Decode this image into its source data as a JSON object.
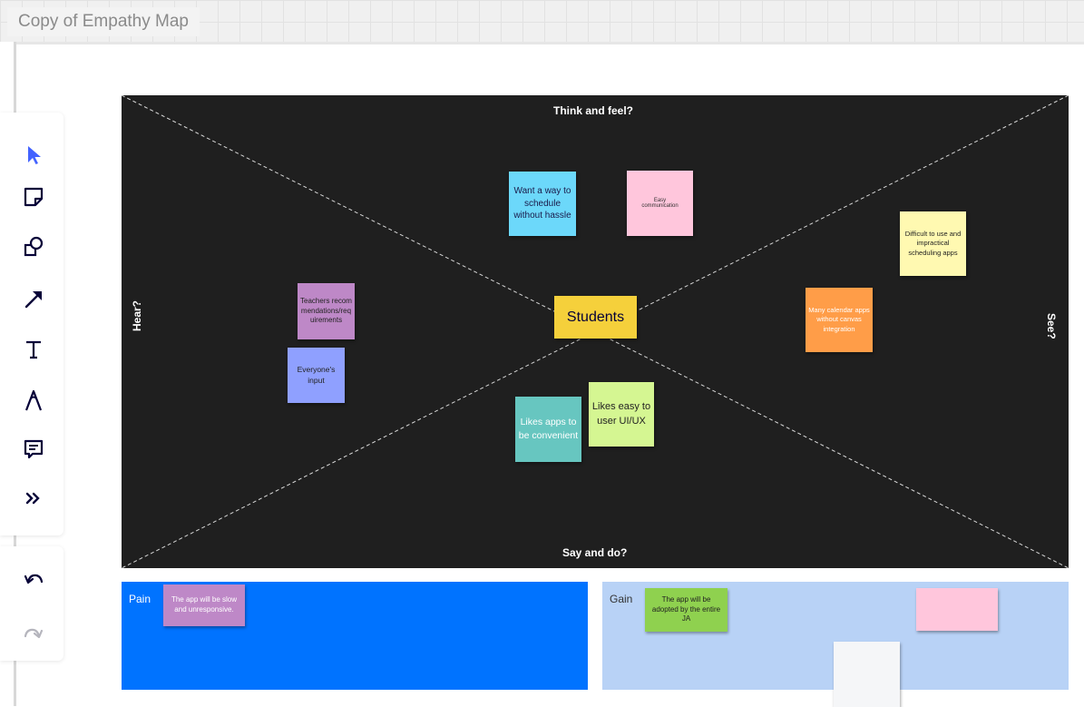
{
  "title": "Copy of Empathy Map",
  "toolbar": {
    "tools": [
      "select-icon",
      "sticky-note-icon",
      "shapes-icon",
      "arrow-icon",
      "text-icon",
      "pen-icon",
      "comment-icon",
      "more-icon"
    ],
    "accent": "#4262ff"
  },
  "history": {
    "undo": "undo-icon",
    "redo": "redo-icon"
  },
  "board": {
    "background": "#1f1f1f",
    "quadrants": {
      "think_feel": "Think and feel?",
      "say_do": "Say and do?",
      "hear": "Hear?",
      "see": "See?"
    },
    "center": {
      "text": "Students",
      "color": "#f5d03b"
    },
    "stickies": [
      {
        "text": "Want a way to schedule without hassle",
        "color": "#6cd8fa"
      },
      {
        "text": "Easy communication",
        "color": "#ffc6dc"
      },
      {
        "text": "Difficult to use and impractical scheduling apps",
        "color": "#fff9b1"
      },
      {
        "text": "Many calendar apps without canvas integration",
        "color": "#ff9d48"
      },
      {
        "text": "Teachers recommendations/requirements",
        "color": "#be88c7"
      },
      {
        "text": "Everyone's input",
        "color": "#8fa0ff"
      },
      {
        "text": "Likes apps to be convenient",
        "color": "#67c6c0"
      },
      {
        "text": "Likes easy to user UI/UX",
        "color": "#d5f692"
      }
    ]
  },
  "pain": {
    "label": "Pain",
    "color": "#0073ff",
    "sticky": {
      "text": "The app will be slow and unresponsive.",
      "color": "#be88c7"
    }
  },
  "gain": {
    "label": "Gain",
    "color": "#b8d2f6",
    "sticky": {
      "text": "The app will be adopted by the entire JA",
      "color": "#8fd14f"
    },
    "blank_stickies": [
      {
        "color": "#ffc6dc"
      },
      {
        "color": "#f5f6f8"
      }
    ]
  }
}
